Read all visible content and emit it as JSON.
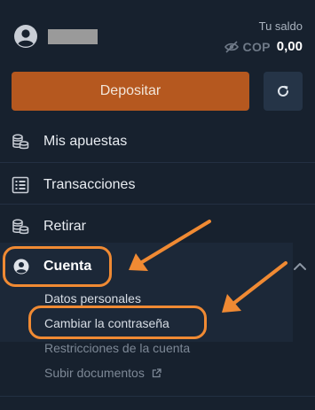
{
  "header": {
    "balance_label": "Tu saldo",
    "currency": "COP",
    "amount": "0,00"
  },
  "actions": {
    "deposit_label": "Depositar"
  },
  "menu": {
    "items": [
      {
        "label": "Mis apuestas",
        "icon": "coins-icon"
      },
      {
        "label": "Transacciones",
        "icon": "list-icon"
      },
      {
        "label": "Retirar",
        "icon": "coins-icon"
      },
      {
        "label": "Cuenta",
        "icon": "user-circle-icon"
      }
    ],
    "account_subitems": [
      {
        "label": "Datos personales"
      },
      {
        "label": "Cambiar la contraseña"
      },
      {
        "label": "Restricciones de la cuenta"
      },
      {
        "label": "Subir documentos",
        "icon": "external-link-icon"
      }
    ]
  },
  "colors": {
    "background": "#17212e",
    "deposit_button": "#b5581f",
    "refresh_button": "#253447",
    "annotation": "#f08a33"
  }
}
